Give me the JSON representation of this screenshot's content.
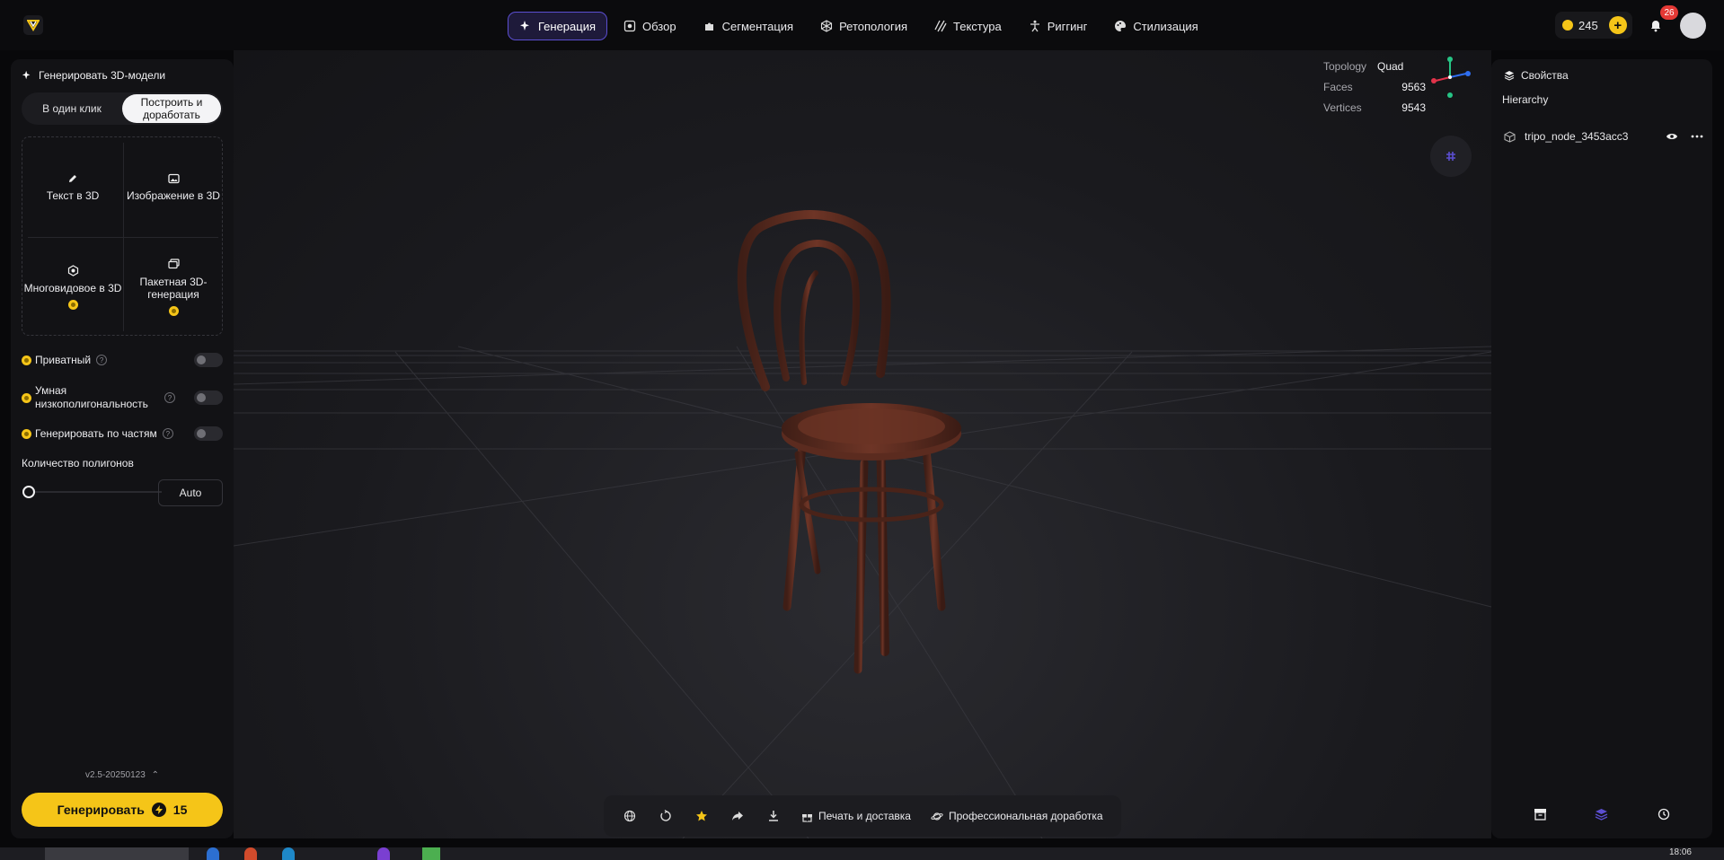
{
  "app": {
    "logo_label": "V"
  },
  "nav": {
    "items": [
      {
        "label": "Генерация",
        "icon": "sparkles-icon"
      },
      {
        "label": "Обзор",
        "icon": "scan-icon"
      },
      {
        "label": "Сегментация",
        "icon": "puzzle-icon"
      },
      {
        "label": "Ретопология",
        "icon": "mesh-icon"
      },
      {
        "label": "Текстура",
        "icon": "texture-icon"
      },
      {
        "label": "Риггинг",
        "icon": "figure-icon"
      },
      {
        "label": "Стилизация",
        "icon": "palette-icon"
      }
    ],
    "active_index": 0
  },
  "header": {
    "credits": "245",
    "notifications": "26"
  },
  "left_panel": {
    "title": "Генерировать 3D-модели",
    "segment": {
      "option_one": "В один клик",
      "option_two": "Построить и доработать",
      "selected": "Построить и доработать"
    },
    "modes": [
      {
        "label": "Текст в 3D",
        "icon": "pencil-icon",
        "premium": false
      },
      {
        "label": "Изображение в 3D",
        "icon": "image-icon",
        "premium": false
      },
      {
        "label": "Многовидовое в 3D",
        "icon": "multiview-icon",
        "premium": true
      },
      {
        "label": "Пакетная 3D-генерация",
        "icon": "batch-icon",
        "premium": true
      }
    ],
    "options": [
      {
        "label": "Приватный",
        "enabled": false
      },
      {
        "label": "Умная низкополигональность",
        "enabled": false
      },
      {
        "label": "Генерировать по частям",
        "enabled": false
      }
    ],
    "polygon_label": "Количество полигонов",
    "polygon_value": "Auto",
    "polygon_slider_fraction": 0,
    "version": "v2.5-20250123",
    "generate_label": "Генерировать",
    "generate_cost": "15"
  },
  "viewport": {
    "stats": [
      {
        "key": "Topology",
        "value": "Quad"
      },
      {
        "key": "Faces",
        "value": "9563"
      },
      {
        "key": "Vertices",
        "value": "9543"
      }
    ],
    "toolbar": {
      "print_label": "Печать и доставка",
      "pro_label": "Профессиональная доработка"
    }
  },
  "right_panel": {
    "title": "Свойства",
    "hierarchy_label": "Hierarchy",
    "node_name": "tripo_node_3453acc3"
  },
  "taskbar": {
    "time": "18:06"
  },
  "colors": {
    "accent": "#5b4ed0",
    "primary": "#f5c518",
    "background": "#0b0b0d"
  }
}
